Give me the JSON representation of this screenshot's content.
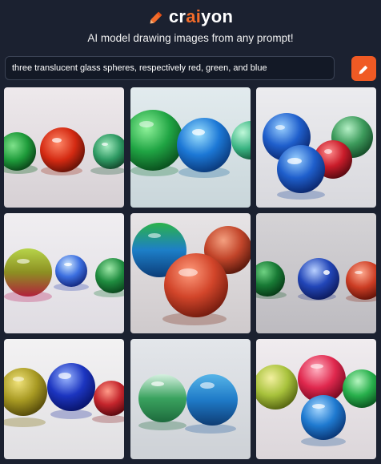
{
  "app": {
    "brand_pre": "cr",
    "brand_ai": "ai",
    "brand_post": "yon",
    "tagline": "AI model drawing images from any prompt!",
    "accent_color": "#f05a24"
  },
  "prompt": {
    "value": "three translucent glass spheres, respectively red, green, and blue",
    "draw_icon": "pencil-icon"
  },
  "gallery": {
    "count": 9,
    "images": [
      "generated-image-1",
      "generated-image-2",
      "generated-image-3",
      "generated-image-4",
      "generated-image-5",
      "generated-image-6",
      "generated-image-7",
      "generated-image-8",
      "generated-image-9"
    ]
  }
}
